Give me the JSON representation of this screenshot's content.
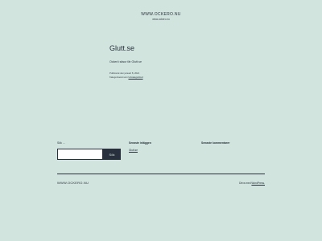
{
  "header": {
    "site_title": "WWW.OCKERO.NU",
    "site_description": "www.ockero.nu"
  },
  "post": {
    "title": "Glutt.se",
    "excerpt": "Ockerö säsur fär Glutt.se",
    "published": "Publicerat den januari 8, 2021",
    "category_prefix": "Kategoriserat som",
    "category": "Uncategorized"
  },
  "widgets": {
    "search": {
      "label": "Sök ...",
      "input_value": "",
      "placeholder": "",
      "button_label": "Sök"
    },
    "recent_posts": {
      "title": "Senaste inläggen",
      "items": [
        "Glutt.se"
      ]
    },
    "recent_comments": {
      "title": "Senaste kommentarer"
    }
  },
  "footer": {
    "site_title": "WWW.OCKERO.NU",
    "powered_prefix": "Drivs med",
    "powered_link": "WordPress."
  },
  "colors": {
    "background": "#d1e4dd",
    "text": "#28303d"
  }
}
